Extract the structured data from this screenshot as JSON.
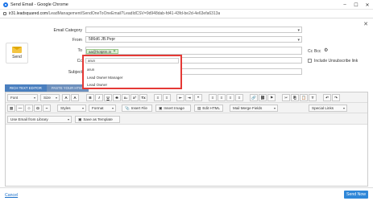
{
  "window": {
    "title": "Send Email - Google Chrome",
    "controls": [
      "–",
      "☐",
      "✕"
    ]
  },
  "address": {
    "domain": "ir31.leadsquared.com",
    "path": "/LeadManagement/SendOneToOneEmail?LeadIdCSV=9d948dab-fd41-43fd-be2d-4e63efa6313a"
  },
  "form": {
    "email_category_label": "Email Category",
    "from_label": "From",
    "from_value": "586d6 JB.Pepr",
    "to_label": "To",
    "to_chip": "aa@hotptm.in",
    "cc_label": "Cc",
    "subject_label": "Subject",
    "cc_link": "Cc",
    "bcc_link": "Bcc",
    "include_unsubscribe": "Include Unsubscribe link"
  },
  "send_panel": {
    "label": "Send"
  },
  "suggest": {
    "input_value": "arun",
    "options": [
      "arun",
      "Lead Owner Manager",
      "Lead Owner"
    ]
  },
  "editor": {
    "tabs": [
      "RICH TEXT EDITOR",
      "PASTE YOUR HTML"
    ],
    "row1": {
      "font": "Font",
      "size": "Size"
    },
    "row2": {
      "styles": "Styles",
      "format": "Format",
      "insert_file": "Insert File",
      "insert_image": "Insert Image",
      "edit_html": "Edit HTML",
      "mail_merge": "Mail Merge Fields",
      "special_links": "Special Links"
    },
    "row3": {
      "library": "Use Email from Library",
      "save_template": "Save as Template"
    }
  },
  "footer": {
    "cancel": "Cancel",
    "send_now": "Send Now"
  }
}
